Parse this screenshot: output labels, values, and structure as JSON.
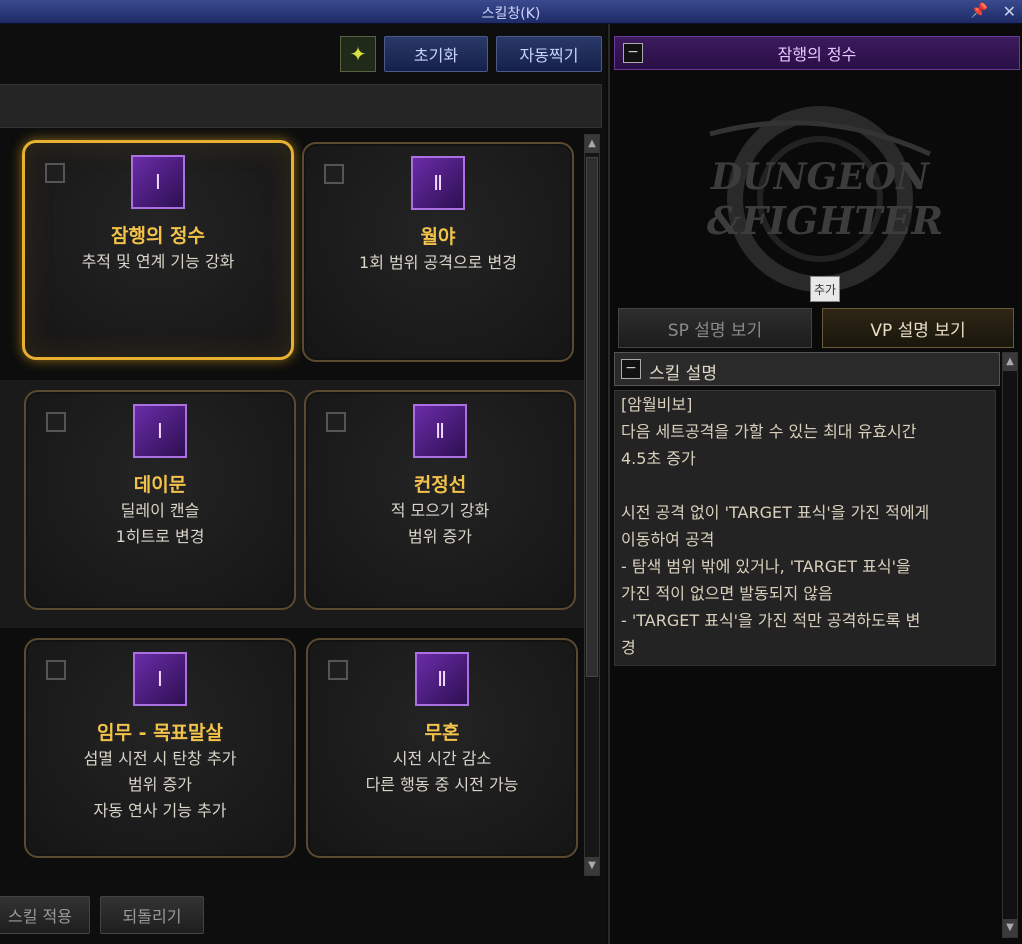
{
  "window": {
    "title": "스킬창(K)"
  },
  "toolbar": {
    "reset_label": "초기화",
    "auto_label": "자동찍기",
    "star_icon": "star-skill-icon"
  },
  "cards": [
    {
      "name": "잠행의 정수",
      "desc": "추적 및 연계 기능 강화",
      "tier": "Ⅰ",
      "selected": true
    },
    {
      "name": "월야",
      "desc": "1회 범위 공격으로 변경",
      "tier": "Ⅱ",
      "selected": false
    },
    {
      "name": "데이문",
      "desc": "딜레이 캔슬\n1히트로 변경",
      "tier": "Ⅰ",
      "selected": false
    },
    {
      "name": "컨정선",
      "desc": "적 모으기 강화\n범위 증가",
      "tier": "Ⅱ",
      "selected": false
    },
    {
      "name": "임무 - 목표말살",
      "desc": "섬멸 시전 시 탄창 추가\n범위 증가\n자동 연사 기능 추가",
      "tier": "Ⅰ",
      "selected": false
    },
    {
      "name": "무혼",
      "desc": "시전 시간 감소\n다른 행동 중 시전 가능",
      "tier": "Ⅱ",
      "selected": false
    }
  ],
  "bottom": {
    "apply_label": "스킬 적용",
    "revert_label": "되돌리기"
  },
  "right": {
    "header_title": "잠행의 정수",
    "logo_text": "DUNGEON & FIGHTER",
    "add_tooltip": "추가",
    "tab_sp": "SP 설명 보기",
    "tab_vp": "VP 설명 보기",
    "desc_title": "스킬 설명",
    "desc_text": "[암월비보]\n다음 세트공격을 가할 수 있는 최대 유효시간\n4.5초 증가\n\n시전 공격 없이 'TARGET 표식'을 가진 적에게\n이동하여 공격\n- 탐색 범위 밖에 있거나, 'TARGET 표식'을\n가진 적이 없으면 발동되지 않음\n- 'TARGET 표식'을 가진 적만 공격하도록 변\n경"
  },
  "colors": {
    "accent_gold": "#e8b030",
    "skill_name": "#f2c24a",
    "header_purple": "#3c1b5e",
    "titlebar_blue": "#2a3a80"
  }
}
